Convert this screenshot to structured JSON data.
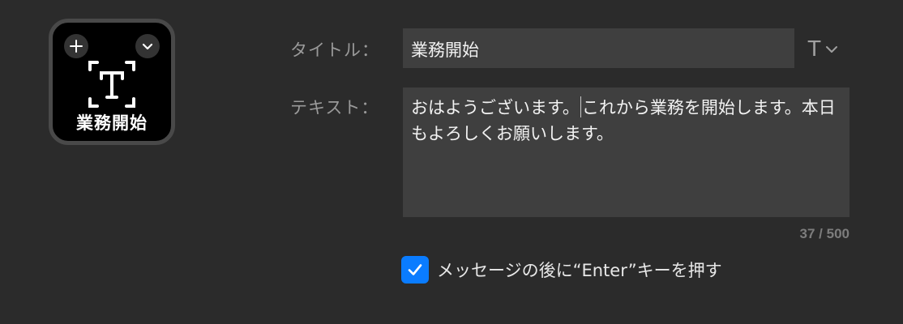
{
  "tile": {
    "label": "業務開始",
    "glyph_icon": "text-cursor-icon",
    "add_icon": "plus-icon",
    "menu_icon": "chevron-down-icon"
  },
  "form": {
    "title_label": "タイトル：",
    "title_value": "業務開始",
    "font_icon": "text-format-icon",
    "text_label": "テキスト：",
    "text_before_caret": "おはようございます。",
    "text_after_caret": "これから業務を開始します。本日もよろしくお願いします。",
    "char_count": "37 / 500"
  },
  "option": {
    "checked": true,
    "label": "メッセージの後に“Enter”キーを押す"
  },
  "colors": {
    "background": "#2b2b2b",
    "field": "#3f3f3f",
    "accent": "#0a7cff"
  }
}
